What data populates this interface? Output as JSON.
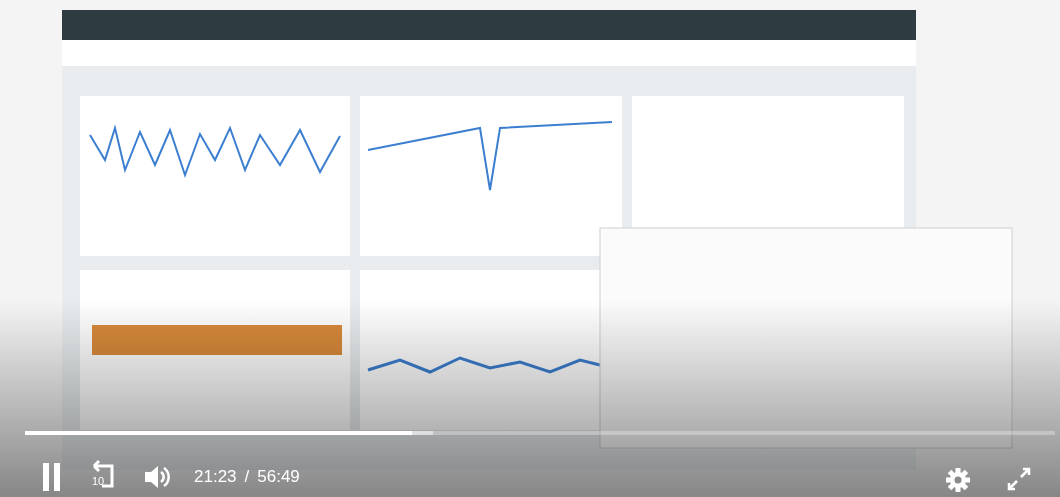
{
  "progress": {
    "level": 0.376
  },
  "controls": {
    "playing": true,
    "rewind_seconds": "10",
    "current_time": "21:23",
    "separator": "/",
    "duration": "56:49"
  }
}
